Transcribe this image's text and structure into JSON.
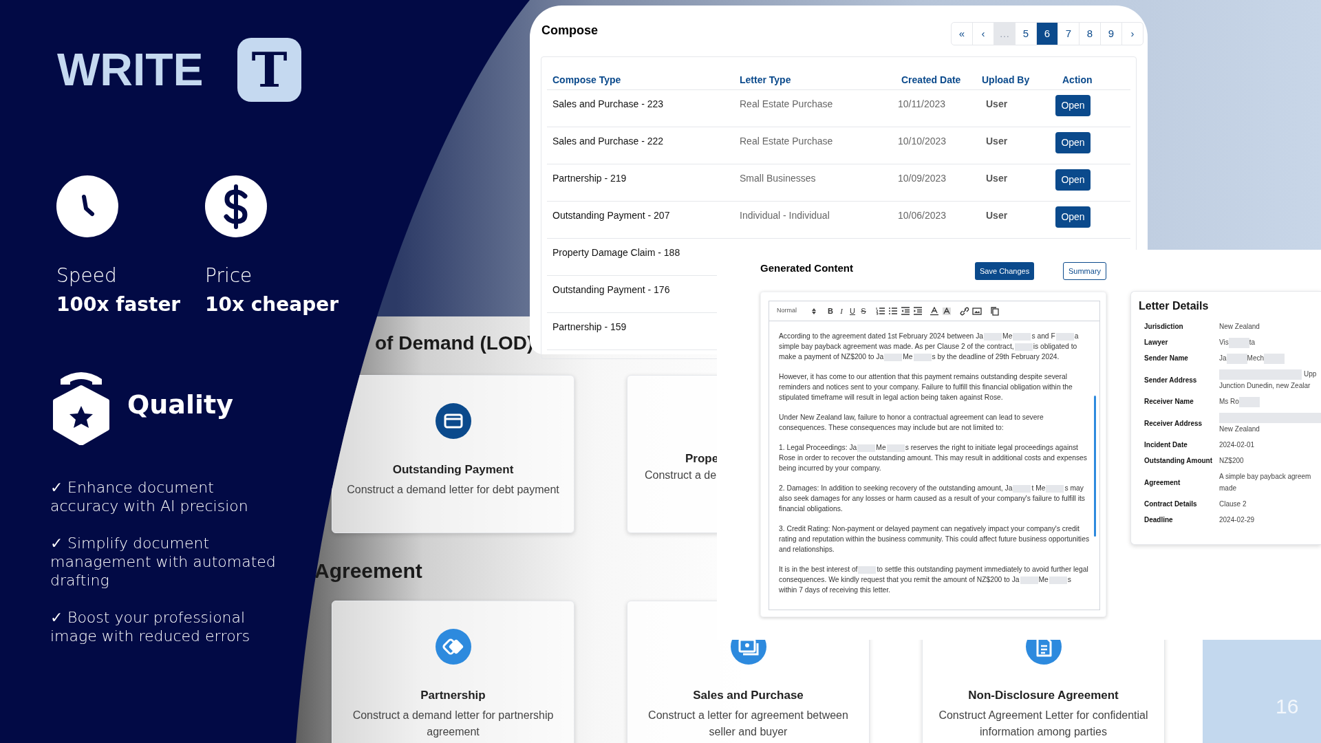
{
  "slide": {
    "brand": "WRITE",
    "logo_letter": "T",
    "page_number": "16"
  },
  "features": [
    {
      "kind": "clock",
      "label": "Speed",
      "value": "100x faster"
    },
    {
      "kind": "dollar",
      "label": "Price",
      "value": "10x cheaper"
    }
  ],
  "quality": {
    "title": "Quality",
    "points": [
      "✓ Enhance document accuracy with AI precision",
      "✓ Simplify document management with automated drafting",
      "✓ Boost your professional image with reduced errors"
    ]
  },
  "app_background": {
    "section_1_title": "of Demand (LOD)",
    "cards_1": [
      {
        "kind": "full",
        "title": "Outstanding Payment",
        "description": "Construct a demand letter for debt payment"
      },
      {
        "kind": "partial",
        "title": "Prope",
        "description": "Construct a de"
      }
    ],
    "section_2_title": "Agreement",
    "cards_2": [
      {
        "kind": "full",
        "title": "Partnership",
        "description": "Construct a demand letter for partnership agreement"
      },
      {
        "kind": "full",
        "title": "Sales and Purchase",
        "description": "Construct a letter for agreement between seller and buyer"
      },
      {
        "kind": "full",
        "title": "Non-Disclosure Agreement",
        "description": "Construct Agreement Letter for confidential information among parties"
      }
    ]
  },
  "compose": {
    "title": "Compose",
    "pagination": [
      {
        "kind": "nav",
        "label": "«",
        "selected": false
      },
      {
        "kind": "nav",
        "label": "‹",
        "selected": false
      },
      {
        "kind": "ellipsis",
        "label": "…",
        "selected": false
      },
      {
        "kind": "page",
        "label": "5",
        "selected": false
      },
      {
        "kind": "page",
        "label": "6",
        "selected": true
      },
      {
        "kind": "page",
        "label": "7",
        "selected": false
      },
      {
        "kind": "page",
        "label": "8",
        "selected": false
      },
      {
        "kind": "page",
        "label": "9",
        "selected": false
      },
      {
        "kind": "nav",
        "label": "›",
        "selected": false
      }
    ],
    "columns": [
      "Compose Type",
      "Letter Type",
      "Created Date",
      "Upload By",
      "Action"
    ],
    "rows": [
      {
        "compose_type": "Sales and Purchase - 223",
        "letter_type": "Real Estate Purchase",
        "created_date": "10/11/2023",
        "upload_by": "User",
        "action": "Open"
      },
      {
        "compose_type": "Sales and Purchase - 222",
        "letter_type": "Real Estate Purchase",
        "created_date": "10/10/2023",
        "upload_by": "User",
        "action": "Open"
      },
      {
        "compose_type": "Partnership - 219",
        "letter_type": "Small Businesses",
        "created_date": "10/09/2023",
        "upload_by": "User",
        "action": "Open"
      },
      {
        "compose_type": "Outstanding Payment - 207",
        "letter_type": "Individual - Individual",
        "created_date": "10/06/2023",
        "upload_by": "User",
        "action": "Open"
      },
      {
        "compose_type": "Property Damage Claim - 188"
      },
      {
        "compose_type": "Outstanding Payment - 176"
      },
      {
        "compose_type": "Partnership - 159"
      }
    ]
  },
  "generated_content": {
    "title": "Generated Content",
    "buttons": [
      {
        "kind": "primary",
        "label": "Save Changes"
      },
      {
        "kind": "outline",
        "label": "Summary"
      }
    ],
    "format_select": "Normal",
    "toolbar": [
      {
        "kind": "bold",
        "label": "B"
      },
      {
        "kind": "italic",
        "label": "I"
      },
      {
        "kind": "underline",
        "label": "U"
      },
      {
        "kind": "strike",
        "label": "S"
      }
    ],
    "paragraphs": [
      [
        "According to the agreement dated 1st February 2024 between Ja",
        {
          "kind": "redacted"
        },
        "Me",
        {
          "kind": "redacted"
        },
        "s and F",
        {
          "kind": "redacted"
        },
        "a simple bay payback agreement was made. As per Clause 2 of the contract,",
        {
          "kind": "redacted"
        },
        "is obligated to make a payment of NZ$200 to Ja",
        {
          "kind": "redacted"
        },
        "Me",
        {
          "kind": "redacted"
        },
        "s by the deadline of 29th February 2024."
      ],
      [
        "However, it has come to our attention that this payment remains outstanding despite several reminders and notices sent to your company. Failure to fulfill this financial obligation within the stipulated timeframe will result in legal action being taken against Rose."
      ],
      [
        "Under New Zealand law, failure to honor a contractual agreement can lead to severe consequences. These consequences may include but are not limited to:"
      ],
      [
        "1. Legal Proceedings: Ja",
        {
          "kind": "redacted"
        },
        "Me",
        {
          "kind": "redacted"
        },
        "s reserves the right to initiate legal proceedings against Rose in order to recover the outstanding amount. This may result in additional costs and expenses being incurred by your company."
      ],
      [
        "2. Damages: In addition to seeking recovery of the outstanding amount, Ja",
        {
          "kind": "redacted"
        },
        "t Me",
        {
          "kind": "redacted"
        },
        "s may also seek damages for any losses or harm caused as a result of your company's failure to fulfill its financial obligations."
      ],
      [
        "3. Credit Rating: Non-payment or delayed payment can negatively impact your company's credit rating and reputation within the business community. This could affect future business opportunities and relationships."
      ],
      [
        "It is in the best interest of",
        {
          "kind": "redacted"
        },
        "to settle this outstanding payment immediately to avoid further legal consequences. We kindly request that you remit the amount of NZ$200 to Ja",
        {
          "kind": "redacted"
        },
        "Me",
        {
          "kind": "redacted"
        },
        "s within 7 days of receiving this letter."
      ]
    ]
  },
  "letter_details": {
    "title": "Letter Details",
    "fields": [
      {
        "label": "Jurisdiction",
        "lines": [
          [
            "New Zealand"
          ]
        ]
      },
      {
        "label": "Lawyer",
        "lines": [
          [
            "Vis",
            {
              "kind": "redacted"
            },
            "ta"
          ]
        ]
      },
      {
        "label": "Sender Name",
        "lines": [
          [
            "Ja",
            {
              "kind": "redacted"
            },
            "Mech",
            {
              "kind": "redacted"
            }
          ]
        ]
      },
      {
        "label": "Sender Address",
        "lines": [
          [
            {
              "kind": "redacted"
            },
            "Upp"
          ],
          [
            "Junction Dunedin, new Zealar"
          ]
        ]
      },
      {
        "label": "Receiver Name",
        "lines": [
          [
            "Ms Ro",
            {
              "kind": "redacted"
            }
          ]
        ]
      },
      {
        "label": "Receiver Address",
        "lines": [
          [
            {
              "kind": "redacted"
            }
          ],
          [
            "New Zealand"
          ]
        ]
      },
      {
        "label": "Incident Date",
        "lines": [
          [
            "2024-02-01"
          ]
        ]
      },
      {
        "label": "Outstanding Amount",
        "lines": [
          [
            "NZ$200"
          ]
        ]
      },
      {
        "label": "Agreement",
        "lines": [
          [
            "A simple bay payback agreem"
          ],
          [
            "made"
          ]
        ]
      },
      {
        "label": "Contract Details",
        "lines": [
          [
            "Clause 2"
          ]
        ]
      },
      {
        "label": "Deadline",
        "lines": [
          [
            "2024-02-29"
          ]
        ]
      }
    ]
  }
}
